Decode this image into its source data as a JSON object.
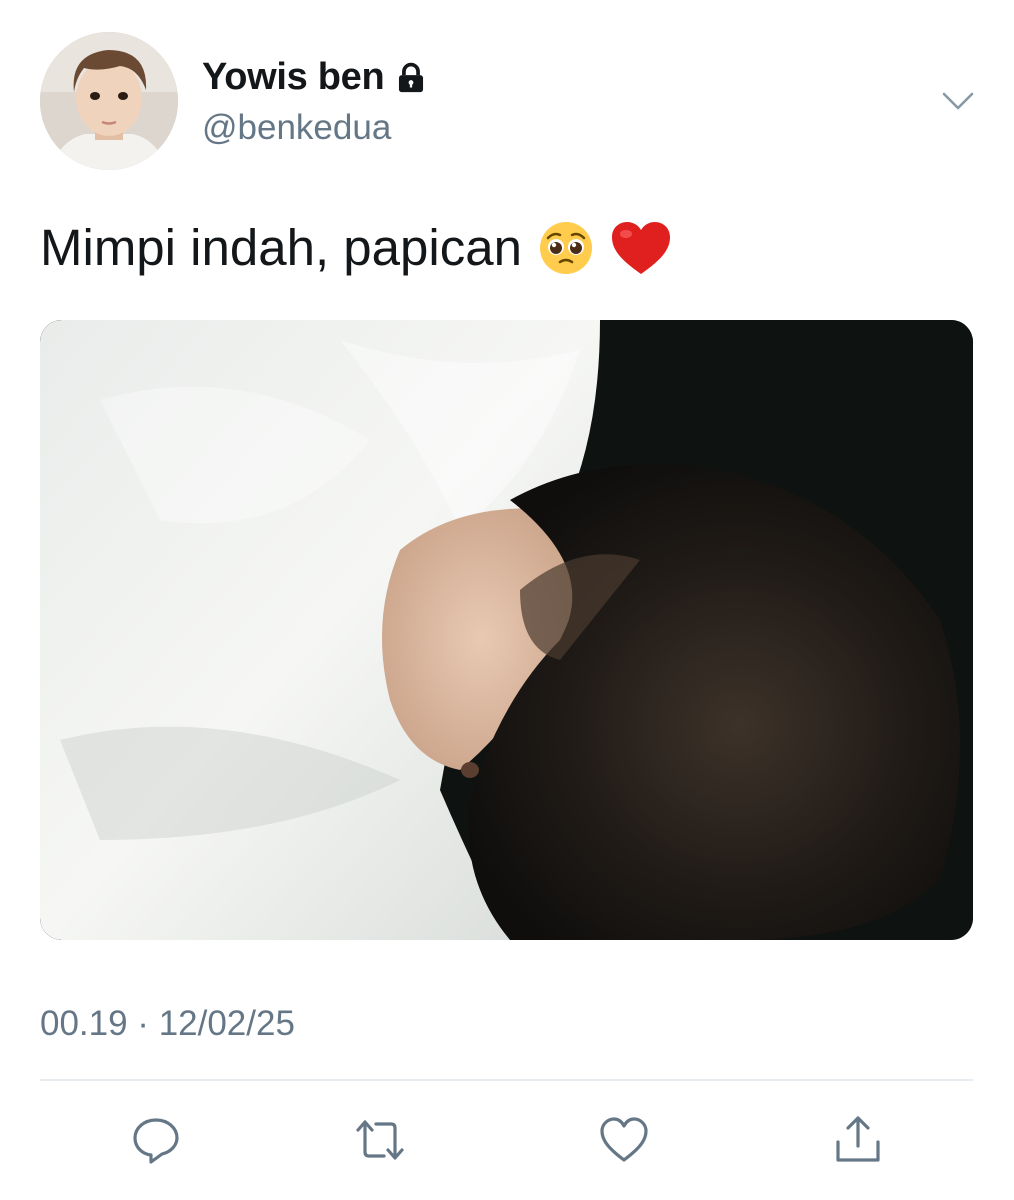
{
  "user": {
    "display_name": "Yowis ben",
    "handle": "@benkedua",
    "protected_icon": "lock-icon",
    "avatar_icon": "avatar"
  },
  "tweet": {
    "text": "Mimpi indah, papican",
    "emojis": [
      "pleading-face-emoji",
      "red-heart-emoji"
    ],
    "timestamp": "00.19 · 12/02/25"
  },
  "menu": {
    "icon": "chevron-down-icon"
  },
  "actions": [
    {
      "name": "reply",
      "icon": "reply-icon"
    },
    {
      "name": "retweet",
      "icon": "retweet-icon"
    },
    {
      "name": "like",
      "icon": "heart-icon"
    },
    {
      "name": "share",
      "icon": "share-icon"
    }
  ],
  "colors": {
    "text_primary": "#14171a",
    "text_secondary": "#657786",
    "divider": "#e6ecf0",
    "action_icon": "#657786",
    "heart_emoji": "#e0201f"
  }
}
